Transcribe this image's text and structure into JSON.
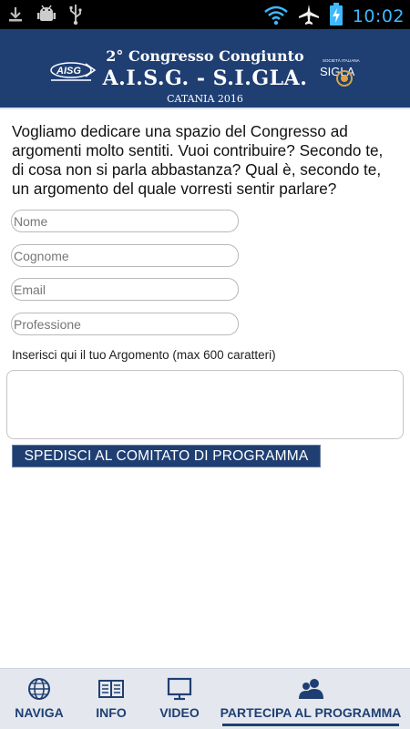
{
  "status_bar": {
    "time": "10:02",
    "left_icons": [
      "download-icon",
      "android-debug-icon",
      "usb-icon"
    ],
    "right_icons": [
      "wifi-icon",
      "airplane-icon",
      "battery-charging-icon"
    ]
  },
  "header": {
    "line1": "2° Congresso Congiunto",
    "line2": "A.I.S.G. - S.I.GLA.",
    "line3": "CATANIA 2016",
    "logo_left_text": "AISG",
    "logo_right_text": "SIGLA",
    "logo_right_caption": "SOCIETÀ ITALIANA",
    "background_color": "#1f3f73"
  },
  "intro_text": "Vogliamo dedicare una spazio del Congresso ad argomenti molto sentiti. Vuoi contribuire? Secondo te, di cosa non si parla abbastanza? Qual è, secondo te, un argomento del quale vorresti sentir parlare?",
  "form": {
    "name_placeholder": "Nome",
    "surname_placeholder": "Cognome",
    "email_placeholder": "Email",
    "profession_placeholder": "Professione",
    "topic_label": "Inserisci qui il tuo Argomento (max 600 caratteri)",
    "submit_label": "SPEDISCI AL COMITATO DI PROGRAMMA"
  },
  "bottom_nav": {
    "items": [
      {
        "label": "NAVIGA",
        "icon": "globe-icon"
      },
      {
        "label": "INFO",
        "icon": "book-icon"
      },
      {
        "label": "VIDEO",
        "icon": "monitor-icon"
      },
      {
        "label": "PARTECIPA AL PROGRAMMA",
        "icon": "people-icon",
        "active": true
      }
    ]
  }
}
